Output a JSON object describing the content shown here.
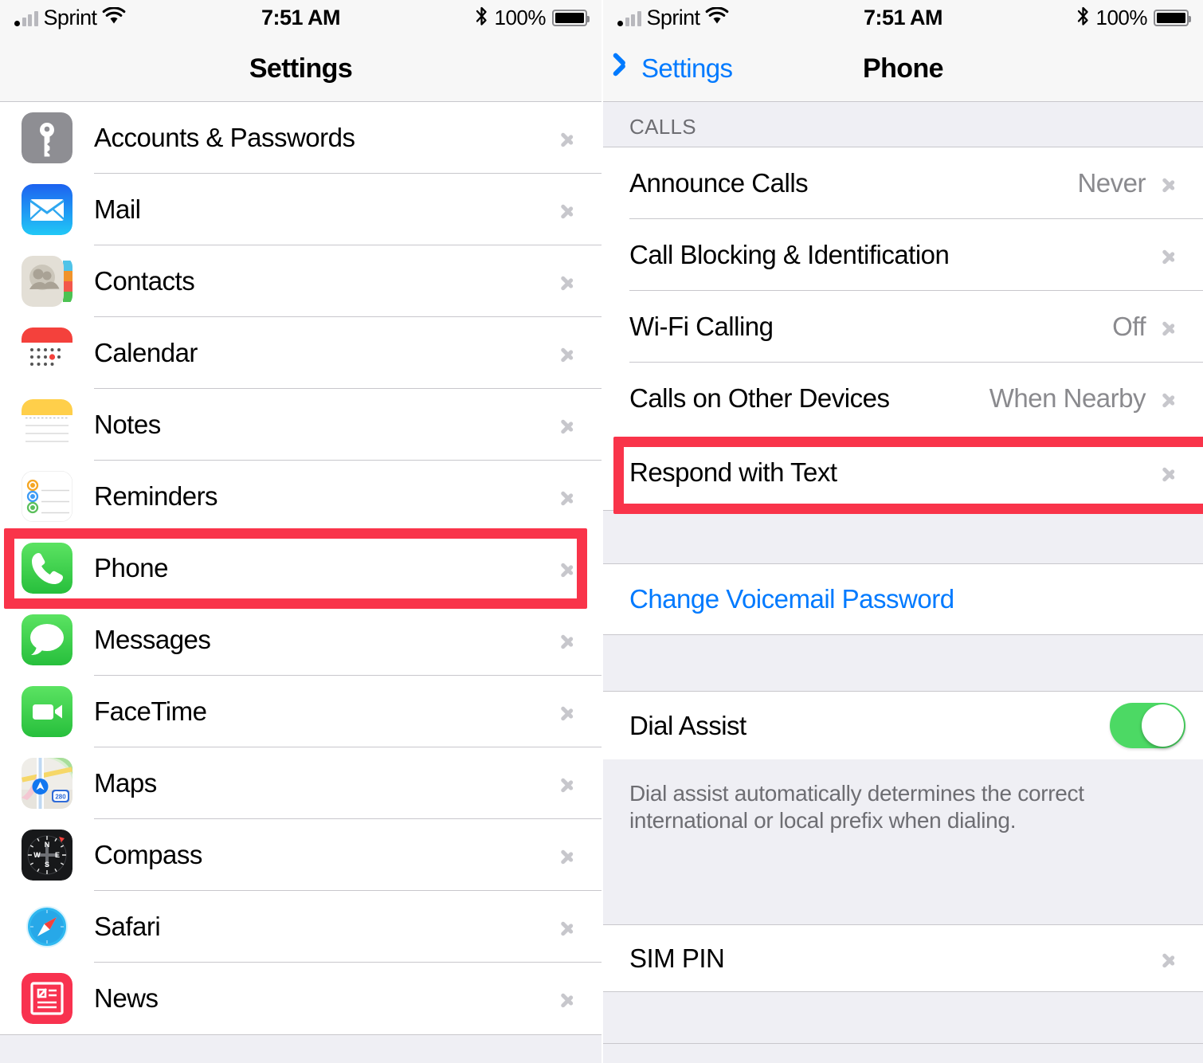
{
  "statusbar": {
    "carrier": "Sprint",
    "time": "7:51 AM",
    "battery_percent": "100%",
    "wifi_icon": "wifi-icon",
    "bluetooth_icon": "bluetooth-icon",
    "signal_icon": "cellular-signal-icon",
    "battery_icon": "battery-full-icon"
  },
  "colors": {
    "accent_blue": "#007AFF",
    "highlight_red": "#F9344A",
    "toggle_green": "#4CD964",
    "group_gray": "#EFEFF4",
    "separator": "#C8C7CC",
    "value_gray": "#8A8A8E"
  },
  "left": {
    "title": "Settings",
    "items": [
      {
        "label": "Accounts & Passwords",
        "icon": "key-icon"
      },
      {
        "label": "Mail",
        "icon": "mail-icon"
      },
      {
        "label": "Contacts",
        "icon": "contacts-icon"
      },
      {
        "label": "Calendar",
        "icon": "calendar-icon"
      },
      {
        "label": "Notes",
        "icon": "notes-icon"
      },
      {
        "label": "Reminders",
        "icon": "reminders-icon"
      },
      {
        "label": "Phone",
        "icon": "phone-icon",
        "highlighted": true
      },
      {
        "label": "Messages",
        "icon": "messages-icon"
      },
      {
        "label": "FaceTime",
        "icon": "facetime-icon"
      },
      {
        "label": "Maps",
        "icon": "maps-icon"
      },
      {
        "label": "Compass",
        "icon": "compass-icon"
      },
      {
        "label": "Safari",
        "icon": "safari-icon"
      },
      {
        "label": "News",
        "icon": "news-icon"
      }
    ]
  },
  "right": {
    "back_label": "Settings",
    "title": "Phone",
    "section_calls_header": "CALLS",
    "calls_rows": [
      {
        "label": "Announce Calls",
        "value": "Never"
      },
      {
        "label": "Call Blocking & Identification",
        "value": ""
      },
      {
        "label": "Wi-Fi Calling",
        "value": "Off"
      },
      {
        "label": "Calls on Other Devices",
        "value": "When Nearby"
      },
      {
        "label": "Respond with Text",
        "value": "",
        "highlighted": true
      }
    ],
    "voicemail_link": "Change Voicemail Password",
    "dial_assist": {
      "label": "Dial Assist",
      "enabled": true,
      "footnote": "Dial assist automatically determines the correct international or local prefix when dialing."
    },
    "sim_pin": {
      "label": "SIM PIN"
    }
  }
}
